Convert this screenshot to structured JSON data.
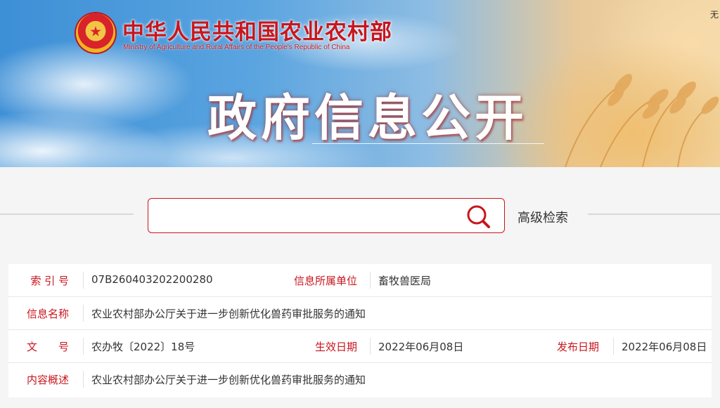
{
  "header": {
    "ministry_cn": "中华人民共和国农业农村部",
    "ministry_en": "Ministry of Agriculture and Rural Affairs of the People's Republic of China",
    "top_link": "无",
    "hero_title": "政府信息公开"
  },
  "search": {
    "value": "",
    "placeholder": "",
    "icon": "search-icon",
    "advanced_label": "高级检索"
  },
  "info": {
    "index_label": "索 引 号",
    "index_value": "07B260403202200280",
    "unit_label": "信息所属单位",
    "unit_value": "畜牧兽医局",
    "name_label": "信息名称",
    "name_value": "农业农村部办公厅关于进一步创新优化兽药审批服务的通知",
    "doc_label": "文　　号",
    "doc_value": "农办牧〔2022〕18号",
    "effective_label": "生效日期",
    "effective_value": "2022年06月08日",
    "publish_label": "发布日期",
    "publish_value": "2022年06月08日",
    "summary_label": "内容概述",
    "summary_value": "农业农村部办公厅关于进一步创新优化兽药审批服务的通知"
  },
  "colors": {
    "accent": "#c8161d",
    "text": "#333333",
    "background": "#f5f5f5"
  }
}
